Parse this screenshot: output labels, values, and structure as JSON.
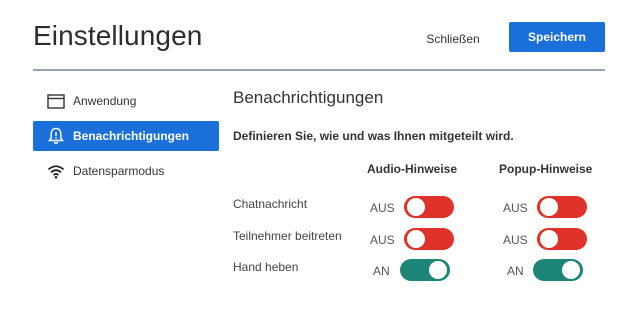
{
  "header": {
    "title": "Einstellungen",
    "close_label": "Schließen",
    "save_label": "Speichern"
  },
  "sidebar": {
    "items": [
      {
        "label": "Anwendung",
        "icon": "window-icon",
        "active": false
      },
      {
        "label": "Benachrichtigungen",
        "icon": "bell-icon",
        "active": true
      },
      {
        "label": "Datensparmodus",
        "icon": "wifi-icon",
        "active": false
      }
    ]
  },
  "main": {
    "section_title": "Benachrichtigungen",
    "description": "Definieren Sie, wie und was Ihnen mitgeteilt wird.",
    "columns": [
      "Audio-Hinweise",
      "Popup-Hinweise"
    ],
    "rows": [
      {
        "label": "Chatnachricht",
        "audio": {
          "state": "AUS",
          "on": false
        },
        "popup": {
          "state": "AUS",
          "on": false
        }
      },
      {
        "label": "Teilnehmer beitreten",
        "audio": {
          "state": "AUS",
          "on": false
        },
        "popup": {
          "state": "AUS",
          "on": false
        }
      },
      {
        "label": "Hand heben",
        "audio": {
          "state": "AN",
          "on": true
        },
        "popup": {
          "state": "AN",
          "on": true
        }
      }
    ]
  },
  "colors": {
    "accent": "#1a6fd8",
    "toggle_off": "#e0312a",
    "toggle_on": "#1c8577"
  }
}
